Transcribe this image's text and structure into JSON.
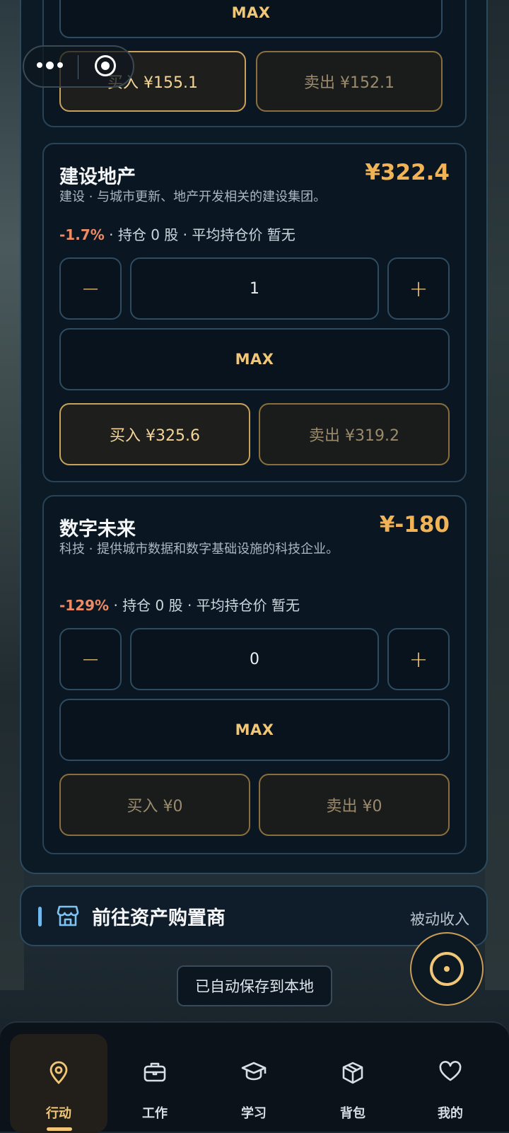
{
  "top_card": {
    "max_label": "MAX",
    "buy_label": "买入 ¥155.1",
    "sell_label": "卖出 ¥152.1"
  },
  "stocks": [
    {
      "name": "建设地产",
      "price": "¥322.4",
      "description": "建设 · 与城市更新、地产开发相关的建设集团。",
      "change": "-1.7%",
      "holding": "· 持仓 0 股 · 平均持仓价 暂无",
      "quantity": "1",
      "minus": "−",
      "plus": "+",
      "max_label": "MAX",
      "buy_label": "买入 ¥325.6",
      "sell_label": "卖出 ¥319.2"
    },
    {
      "name": "数字未来",
      "price": "¥-180",
      "description": "科技 · 提供城市数据和数字基础设施的科技企业。",
      "change": "-129%",
      "holding": "· 持仓 0 股 · 平均持仓价 暂无",
      "quantity": "0",
      "minus": "−",
      "plus": "+",
      "max_label": "MAX",
      "buy_label": "买入 ¥0",
      "sell_label": "卖出 ¥0"
    }
  ],
  "shop": {
    "title": "前往资产购置商",
    "right_label": "被动收入",
    "icon": "store-icon"
  },
  "save_status": "已自动保存到本地",
  "nav": {
    "items": [
      {
        "label": "行动",
        "icon": "location-pin-icon",
        "active": true
      },
      {
        "label": "工作",
        "icon": "briefcase-icon",
        "active": false
      },
      {
        "label": "学习",
        "icon": "graduation-cap-icon",
        "active": false
      },
      {
        "label": "背包",
        "icon": "package-icon",
        "active": false
      },
      {
        "label": "我的",
        "icon": "heart-icon",
        "active": false
      }
    ]
  },
  "colors": {
    "accent_gold": "#f1c777",
    "price_orange": "#f1b356",
    "negative": "#ec8b66",
    "panel_border": "#2c4a5e"
  }
}
